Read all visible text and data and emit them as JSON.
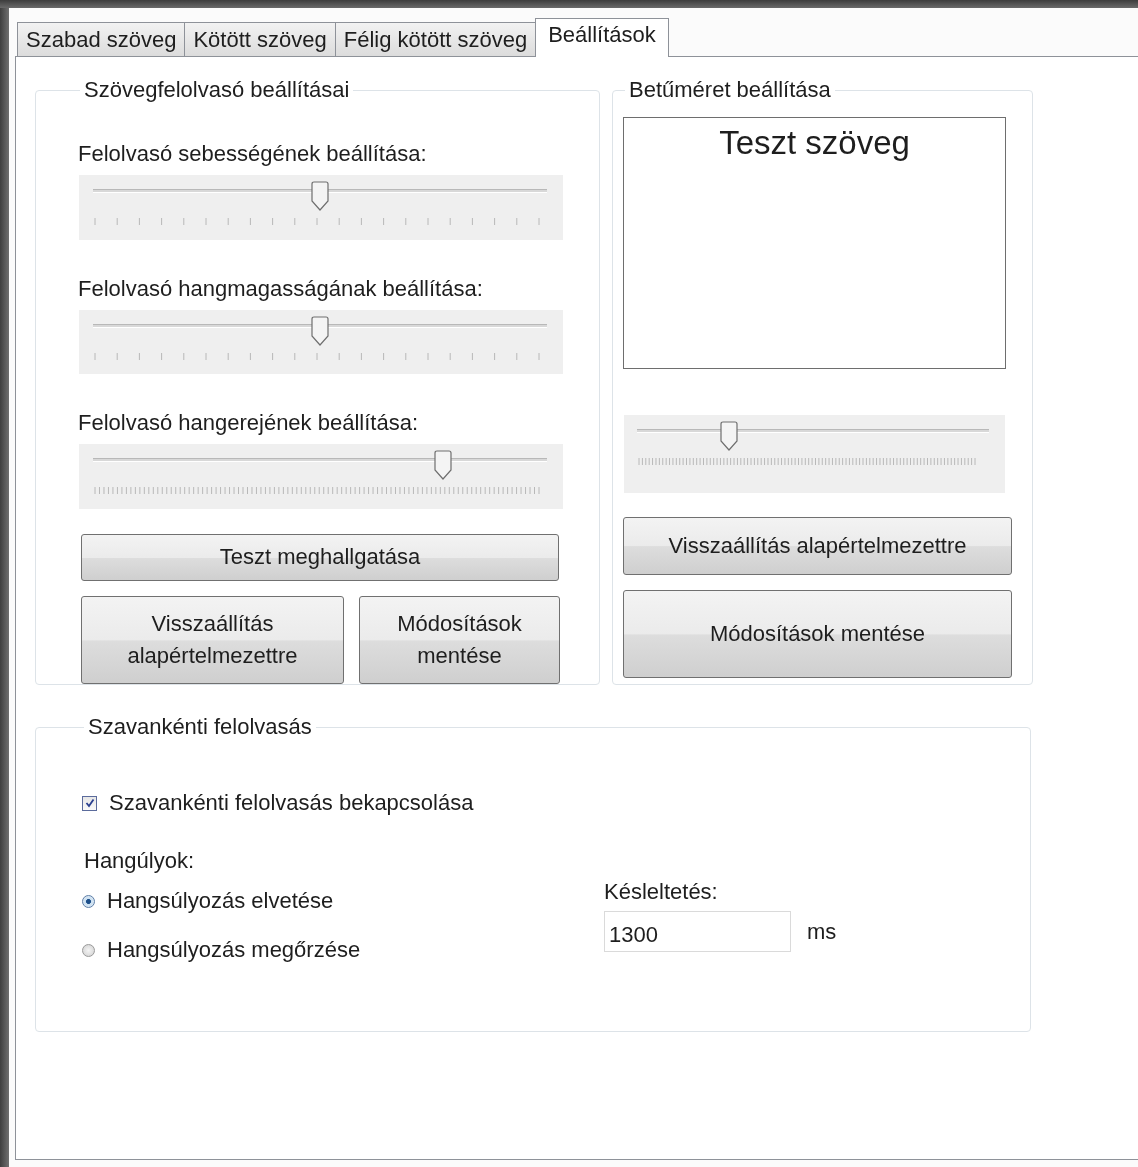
{
  "tabs": [
    {
      "label": "Szabad szöveg",
      "selected": false
    },
    {
      "label": "Kötött szöveg",
      "selected": false
    },
    {
      "label": "Félig kötött szöveg",
      "selected": false
    },
    {
      "label": "Beállítások",
      "selected": true
    }
  ],
  "reader_settings": {
    "title": "Szövegfelolvasó beállításai",
    "sliders": [
      {
        "label": "Felolvasó sebességének beállítása:",
        "level": 0.5,
        "kind": "coarse"
      },
      {
        "label": "Felolvasó hangmagasságának beállítása:",
        "level": 0.5,
        "kind": "coarse"
      },
      {
        "label": "Felolvasó hangerejének beállítása:",
        "level": 0.77,
        "kind": "fine"
      }
    ],
    "test_button": "Teszt meghallgatása",
    "reset_button": "Visszaállítás alapértelmezettre",
    "save_button": "Módosítások mentése"
  },
  "font_size": {
    "title": "Betűméret beállítása",
    "preview": "Teszt szöveg",
    "slider": {
      "level": 0.26,
      "kind": "fine"
    },
    "reset_button": "Visszaállítás alapértelmezettre",
    "save_button": "Módosítások mentése"
  },
  "word_reading": {
    "title": "Szavankénti felolvasás",
    "checkbox": {
      "label": "Szavankénti felolvasás bekapcsolása",
      "checked": true
    },
    "accent_label": "Hangúlyok:",
    "radios": [
      {
        "label": "Hangsúlyozás elvetése",
        "selected": true
      },
      {
        "label": "Hangsúlyozás megőrzése",
        "selected": false
      }
    ],
    "delay_label": "Késleltetés:",
    "delay_value": "1300",
    "delay_unit": "ms"
  }
}
